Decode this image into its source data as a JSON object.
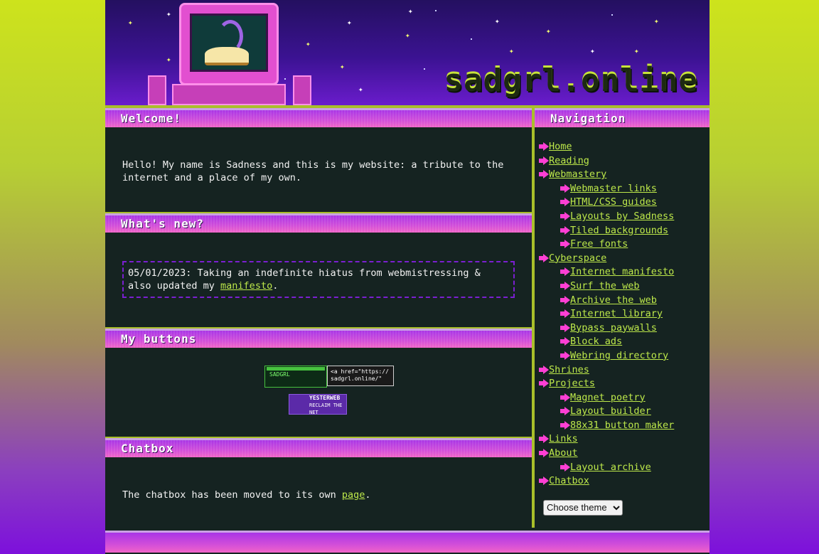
{
  "header": {
    "site_title": "sadgrl.online"
  },
  "welcome": {
    "title": "Welcome!",
    "text": "Hello! My name is Sadness and this is my website: a tribute to the internet and a place of my own."
  },
  "whats_new": {
    "title": "What's new?",
    "entry_prefix": "05/01/2023: Taking an indefinite hiatus from webmistressing & also updated my ",
    "entry_link": "manifesto",
    "entry_suffix": "."
  },
  "buttons": {
    "title": "My buttons",
    "sadgrl_label": "SADGRL",
    "code_label": "<a href=\"https:// sadgrl.online/\"",
    "yesterweb_label": "YESTERWEB",
    "yesterweb_sub": "RECLAIM THE NET"
  },
  "chatbox": {
    "title": "Chatbox",
    "text_prefix": "The chatbox has been moved to its own ",
    "link": "page",
    "text_suffix": "."
  },
  "navigation": {
    "title": "Navigation",
    "items": [
      {
        "label": "Home",
        "level": 1
      },
      {
        "label": "Reading",
        "level": 1
      },
      {
        "label": "Webmastery",
        "level": 1
      },
      {
        "label": "Webmaster links",
        "level": 2
      },
      {
        "label": "HTML/CSS guides",
        "level": 2
      },
      {
        "label": "Layouts by Sadness",
        "level": 2
      },
      {
        "label": "Tiled backgrounds",
        "level": 2
      },
      {
        "label": "Free fonts",
        "level": 2
      },
      {
        "label": "Cyberspace",
        "level": 1
      },
      {
        "label": "Internet manifesto",
        "level": 2
      },
      {
        "label": "Surf the web",
        "level": 2
      },
      {
        "label": "Archive the web",
        "level": 2
      },
      {
        "label": "Internet library",
        "level": 2
      },
      {
        "label": "Bypass paywalls",
        "level": 2
      },
      {
        "label": "Block ads",
        "level": 2
      },
      {
        "label": "Webring directory",
        "level": 2
      },
      {
        "label": "Shrines",
        "level": 1
      },
      {
        "label": "Projects",
        "level": 1
      },
      {
        "label": "Magnet poetry",
        "level": 2
      },
      {
        "label": "Layout builder",
        "level": 2
      },
      {
        "label": "88x31 button maker",
        "level": 2
      },
      {
        "label": "Links",
        "level": 1
      },
      {
        "label": "About",
        "level": 1
      },
      {
        "label": "Layout archive",
        "level": 2
      },
      {
        "label": "Chatbox",
        "level": 1
      }
    ],
    "theme_select": {
      "selected": "Choose theme"
    }
  },
  "colors": {
    "accent_pink": "#ff3fd4",
    "link_green": "#bde84a",
    "panel_bg": "#152321",
    "header_purple": "#3b1292",
    "border_olive": "#a9bf2a"
  }
}
